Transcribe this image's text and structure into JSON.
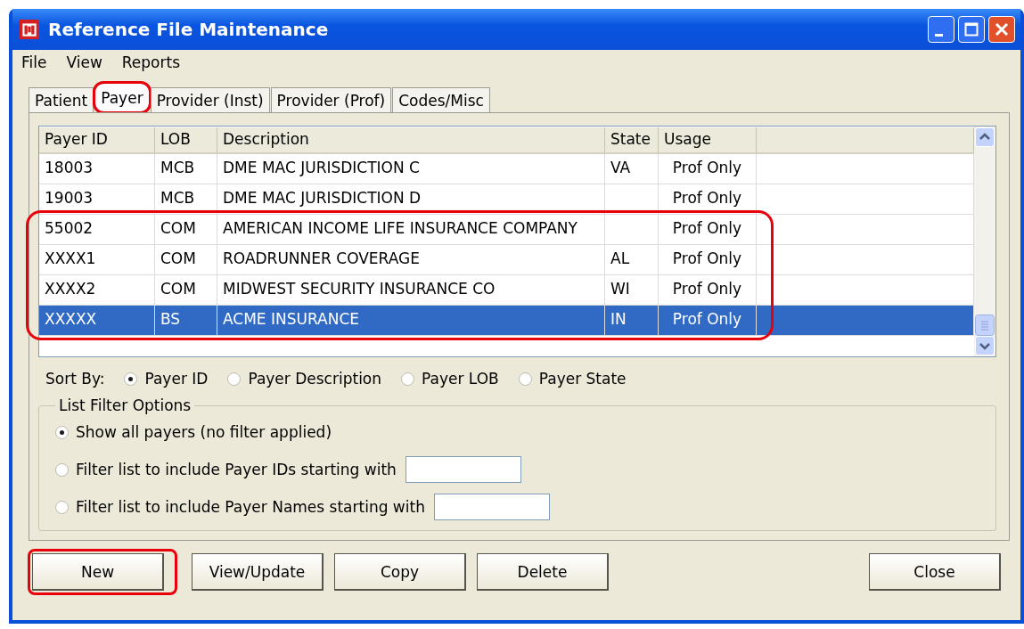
{
  "window": {
    "title": "Reference File Maintenance"
  },
  "menu": [
    "File",
    "View",
    "Reports"
  ],
  "tabs": [
    {
      "label": "Patient",
      "selected": false,
      "highlighted": false
    },
    {
      "label": "Payer",
      "selected": true,
      "highlighted": true
    },
    {
      "label": "Provider (Inst)",
      "selected": false,
      "highlighted": false
    },
    {
      "label": "Provider (Prof)",
      "selected": false,
      "highlighted": false
    },
    {
      "label": "Codes/Misc",
      "selected": false,
      "highlighted": false
    }
  ],
  "table": {
    "columns": [
      "Payer ID",
      "LOB",
      "Description",
      "State",
      "Usage"
    ],
    "rows": [
      {
        "cells": [
          "18003",
          "MCB",
          "DME MAC JURISDICTION C",
          "VA",
          "Prof Only"
        ],
        "selected": false,
        "highlighted": false
      },
      {
        "cells": [
          "19003",
          "MCB",
          "DME MAC JURISDICTION D",
          "",
          "Prof Only"
        ],
        "selected": false,
        "highlighted": false
      },
      {
        "cells": [
          "55002",
          "COM",
          "AMERICAN INCOME LIFE INSURANCE COMPANY",
          "",
          "Prof Only"
        ],
        "selected": false,
        "highlighted": true
      },
      {
        "cells": [
          "XXXX1",
          "COM",
          "ROADRUNNER COVERAGE",
          "AL",
          "Prof Only"
        ],
        "selected": false,
        "highlighted": true
      },
      {
        "cells": [
          "XXXX2",
          "COM",
          "MIDWEST SECURITY INSURANCE CO",
          "WI",
          "Prof Only"
        ],
        "selected": false,
        "highlighted": true
      },
      {
        "cells": [
          "XXXXX",
          "BS",
          "ACME INSURANCE",
          "IN",
          "Prof Only"
        ],
        "selected": true,
        "highlighted": true
      }
    ]
  },
  "sort": {
    "label": "Sort By:",
    "options": [
      {
        "label": "Payer ID",
        "selected": true
      },
      {
        "label": "Payer Description",
        "selected": false
      },
      {
        "label": "Payer LOB",
        "selected": false
      },
      {
        "label": "Payer State",
        "selected": false
      }
    ]
  },
  "filter": {
    "title": "List Filter Options",
    "options": [
      {
        "label": "Show all payers (no filter applied)",
        "selected": true,
        "kind": "plain"
      },
      {
        "label": "Filter list to include Payer IDs starting with",
        "selected": false,
        "kind": "input"
      },
      {
        "label": "Filter list to include Payer Names starting with",
        "selected": false,
        "kind": "input"
      }
    ]
  },
  "buttons": [
    {
      "label": "New",
      "highlighted": true
    },
    {
      "label": "View/Update",
      "highlighted": false
    },
    {
      "label": "Copy",
      "highlighted": false
    },
    {
      "label": "Delete",
      "highlighted": false
    }
  ],
  "close_button": {
    "label": "Close"
  }
}
